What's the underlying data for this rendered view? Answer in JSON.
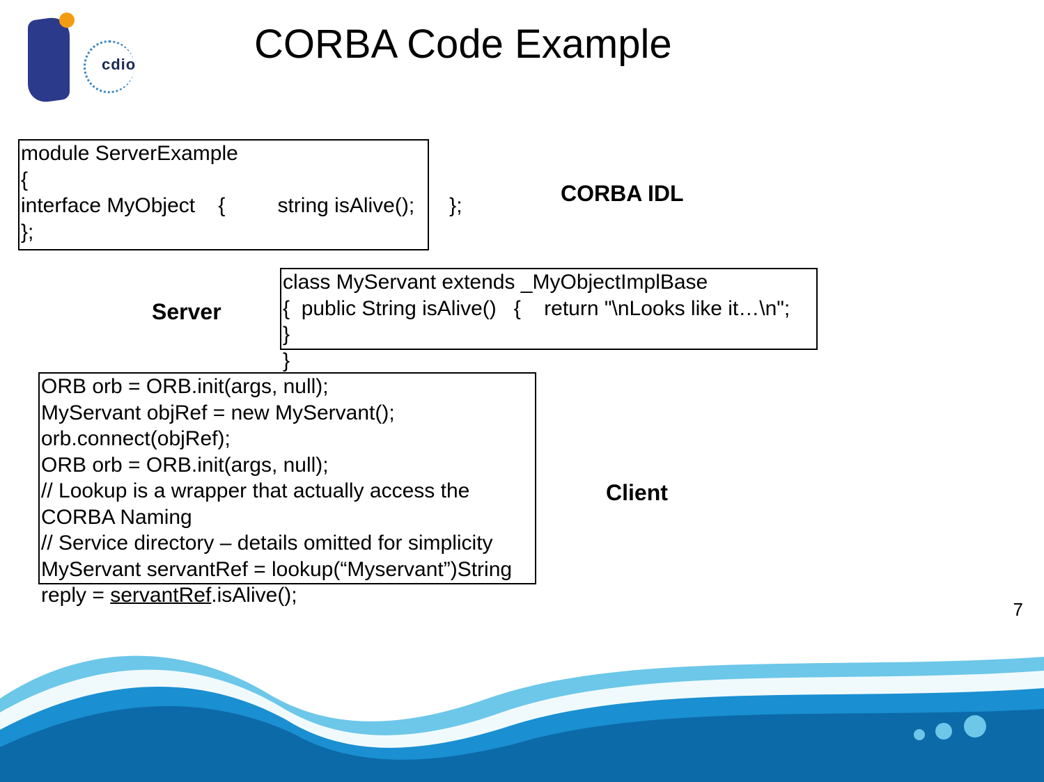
{
  "title": "CORBA Code Example",
  "logo_text": "cdio",
  "idl_label": "CORBA IDL",
  "server_label": "Server",
  "client_label": "Client",
  "idl_code": "module ServerExample\n{\ninterface MyObject    {         string isAlive();      };\n};",
  "server_code": "class MyServant extends _MyObjectImplBase\n{  public String isAlive()   {    return \"\\nLooks like it…\\n\";    }\n}",
  "client_code_pre": "ORB orb = ORB.init(args, null);\nMyServant objRef = new MyServant();\norb.connect(objRef);\nORB orb = ORB.init(args, null);\n// Lookup is a wrapper that actually access the CORBA Naming\n// Service directory – details omitted for simplicity\nMyServant servantRef = lookup(“Myservant”)String\nreply = ",
  "client_code_underlined": "servantRef",
  "client_code_post": ".isAlive();",
  "page_number": "7",
  "colors": {
    "wave_dark": "#0c6aa8",
    "wave_mid": "#1a8fd1",
    "wave_light": "#6cc7e9",
    "wave_white": "#ffffff"
  }
}
